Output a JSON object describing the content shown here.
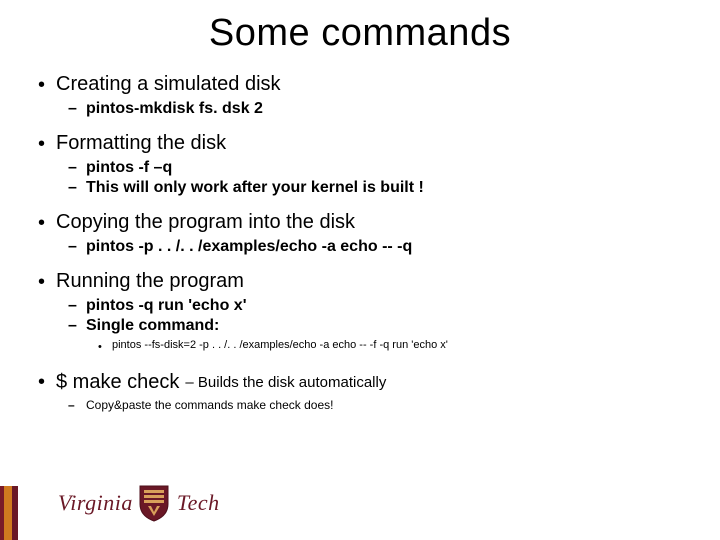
{
  "title": "Some commands",
  "items": [
    {
      "label": "Creating a simulated disk",
      "sub": [
        "pintos-mkdisk fs. dsk 2"
      ]
    },
    {
      "label": "Formatting the disk",
      "sub": [
        "pintos -f –q",
        "This will only work after your kernel is built !"
      ]
    },
    {
      "label": "Copying the program into the disk",
      "sub": [
        "pintos -p . . /. . /examples/echo -a echo -- -q"
      ]
    },
    {
      "label": "Running the program",
      "sub": [
        "pintos -q run 'echo x'",
        "Single command:"
      ],
      "subsub": [
        "pintos --fs-disk=2 -p . . /. . /examples/echo -a echo -- -f -q run 'echo x'"
      ]
    },
    {
      "label": "$ make check",
      "inline": " – Builds the disk automatically",
      "sub_small": [
        "Copy&paste the commands make check does!"
      ]
    }
  ],
  "logo": {
    "part1": "Virginia",
    "part2": "Tech"
  }
}
